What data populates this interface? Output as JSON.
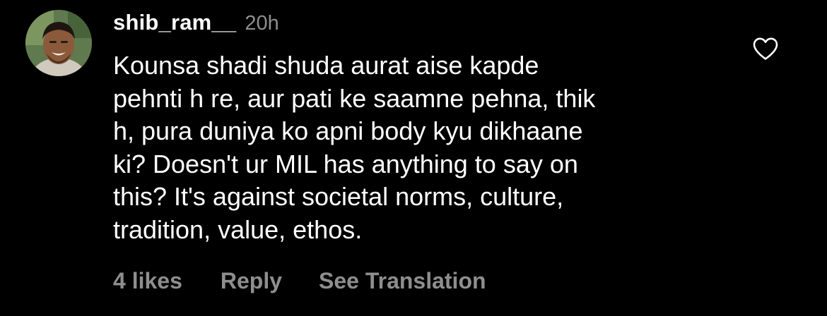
{
  "comment": {
    "username": "shib_ram__",
    "timestamp": "20h",
    "avatar_icon": "user-avatar",
    "body_lines": [
      "Kounsa shadi shuda aurat aise kapde",
      "pehnti h re, aur pati ke saamne pehna, thik",
      "h, pura duniya ko apni body kyu dikhaane",
      "ki? Doesn't ur MIL has anything to say on",
      "this? It's against societal norms, culture,",
      "tradition, value, ethos."
    ],
    "like_icon": "heart-outline-icon",
    "actions": {
      "likes": "4 likes",
      "reply": "Reply",
      "see_translation": "See Translation"
    }
  },
  "colors": {
    "background": "#000000",
    "primary_text": "#ffffff",
    "secondary_text": "#8e8e8e"
  }
}
